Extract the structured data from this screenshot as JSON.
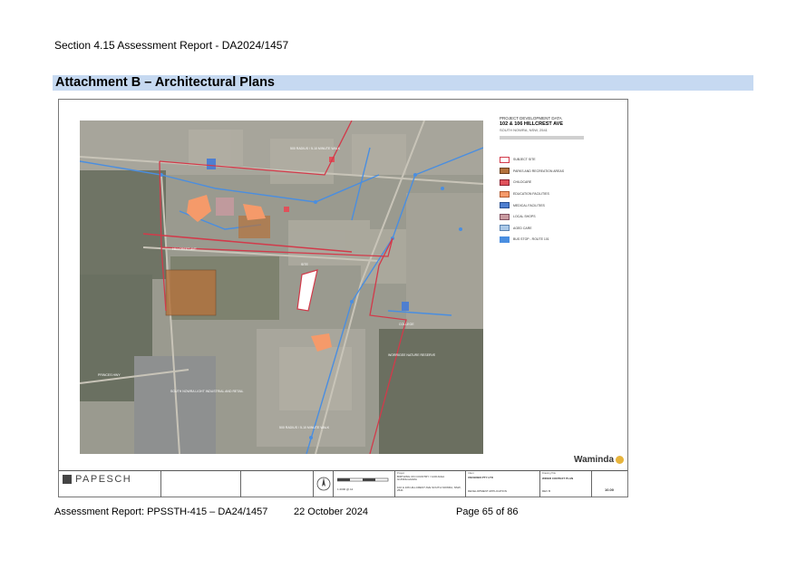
{
  "header": {
    "report_title": "Section 4.15 Assessment Report - DA2024/1457",
    "attachment_title": "Attachment B – Architectural Plans"
  },
  "plan": {
    "legend": {
      "heading": "PROJECT DEVELOPMENT DATA",
      "site_title": "102 & 106 HILLCREST AVE",
      "location": "SOUTH NOWRA, NSW, 2541",
      "items": [
        {
          "label": "SUBJECT SITE",
          "color": "#ffffff",
          "border": "#d23a4a"
        },
        {
          "label": "PARKS AND RECREATION AREAS",
          "color": "#b4723c",
          "border": "#6d4220"
        },
        {
          "label": "CHILDCARE",
          "color": "#e0505a",
          "border": "#8a2030"
        },
        {
          "label": "EDUCATION FACILITIES",
          "color": "#f59a6a",
          "border": "#b25a30"
        },
        {
          "label": "MEDICAL FACILITIES",
          "color": "#4f7fd0",
          "border": "#2a4f90"
        },
        {
          "label": "LOCAL SHOPS",
          "color": "#c99aa0",
          "border": "#805060"
        },
        {
          "label": "AGED CARE",
          "color": "#a9c8e8",
          "border": "#5a82b0"
        },
        {
          "label": "BUS STOP - ROUTE 101",
          "color": "#4a8ee0",
          "border": "#4a8ee0"
        }
      ]
    },
    "map_labels": {
      "walk_top": "500 RADIUS / 5-10 MINUTE WALK",
      "walk_bottom": "500 RADIUS / 5-10 MINUTE WALK",
      "hillcrest_ave": "HILLCREST AVE",
      "site": "SITE",
      "reserve": "WORRIGEE NATURE RESERVE",
      "industrial": "SOUTH NOWRA LIGHT INDUSTRIAL AND RETAIL",
      "highway": "PRINCES HWY",
      "college": "COLLEGE"
    },
    "brand": "Waminda",
    "title_block": {
      "company": "PAPESCH",
      "client_label": "Client",
      "client": "UNCEDED PTY LTD",
      "drawing_label": "Drawing Title",
      "drawing_title": "WIDER CONTEXT PLAN",
      "project_label": "Project",
      "project": "BIRTHING ON COUNTRY / GUDJAGA GUNDILGAARA",
      "address": "102 & 106 HILLCREST AVE SOUTH NOWRA, NSW, 2541",
      "status": "DEVELOPMENT APPLICATION",
      "issue": "REV B",
      "drawing_number": "10.00",
      "scale_note": "1:2000 @ A1"
    }
  },
  "footer": {
    "report": "Assessment Report: PPSSTH-415 – DA24/1457",
    "date": "22 October 2024",
    "page": "Page 65 of 86"
  }
}
